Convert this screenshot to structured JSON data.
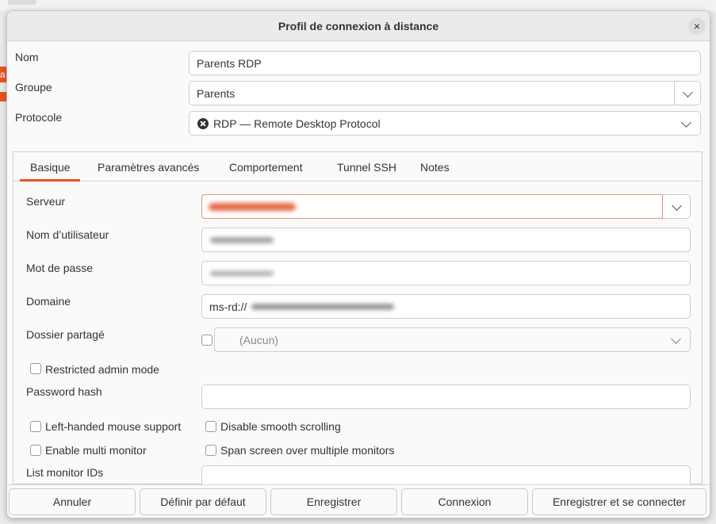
{
  "dialog": {
    "title": "Profil de connexion à distance",
    "close_glyph": "×"
  },
  "background": {
    "orange_fragment": "a"
  },
  "profile": {
    "name_label": "Nom",
    "name_value": "Parents RDP",
    "group_label": "Groupe",
    "group_value": "Parents",
    "protocol_label": "Protocole",
    "protocol_value": "RDP — Remote Desktop Protocol"
  },
  "tabs": [
    {
      "label": "Basique"
    },
    {
      "label": "Paramètres avancés"
    },
    {
      "label": "Comportement"
    },
    {
      "label": "Tunnel SSH"
    },
    {
      "label": "Notes"
    }
  ],
  "basic": {
    "server_label": "Serveur",
    "username_label": "Nom d’utilisateur",
    "password_label": "Mot de passe",
    "domain_label": "Domaine",
    "domain_prefix": "ms-rd://",
    "shared_folder_label": "Dossier partagé",
    "shared_folder_value": "(Aucun)",
    "restricted_admin_label": "Restricted admin mode",
    "password_hash_label": "Password hash",
    "left_handed_label": "Left-handed mouse support",
    "disable_smooth_label": "Disable smooth scrolling",
    "multi_monitor_label": "Enable multi monitor",
    "span_screen_label": "Span screen over multiple monitors",
    "monitor_ids_label": "List monitor IDs"
  },
  "buttons": {
    "cancel": "Annuler",
    "set_default": "Définir par défaut",
    "save": "Enregistrer",
    "connect": "Connexion",
    "save_connect": "Enregistrer et se connecter"
  },
  "colors": {
    "accent": "#e95420",
    "focus_border": "#e8957a"
  },
  "icons": {
    "protocol": "rdp-icon",
    "close": "close-icon",
    "dropdown": "chevron-down-icon"
  }
}
